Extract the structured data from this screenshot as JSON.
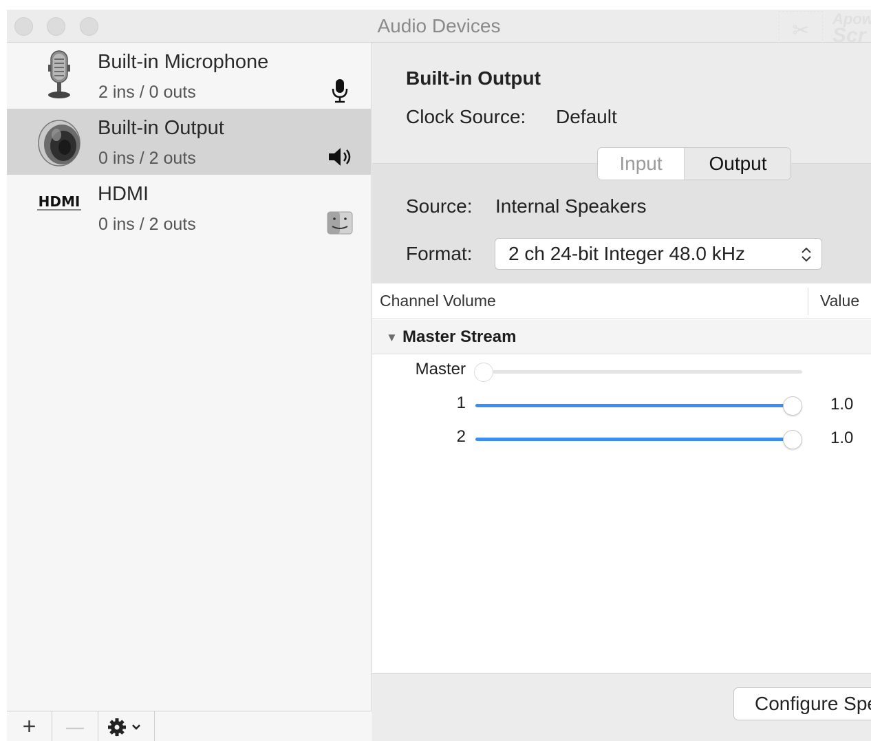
{
  "window": {
    "title": "Audio Devices"
  },
  "watermark": {
    "line1": "Apow",
    "line2": "Scr"
  },
  "devices": [
    {
      "name": "Built-in Microphone",
      "io": "2 ins / 0 outs",
      "icon": "microphone-icon",
      "badge": "mic-badge-icon",
      "selected": false
    },
    {
      "name": "Built-in Output",
      "io": "0 ins / 2 outs",
      "icon": "speaker-icon",
      "badge": "volume-badge-icon",
      "selected": true
    },
    {
      "name": "HDMI",
      "io": "0 ins / 2 outs",
      "icon": "hdmi-logo-icon",
      "icon_text": "HDMI",
      "badge": "finder-badge-icon",
      "selected": false
    }
  ],
  "sidebar_footer": {
    "add": "+",
    "remove": "—",
    "actions_icon": "gear-icon"
  },
  "detail": {
    "title": "Built-in Output",
    "clock_source_label": "Clock Source:",
    "clock_source_value": "Default",
    "tabs": [
      "Input",
      "Output"
    ],
    "selected_tab": "Output",
    "source_label": "Source:",
    "source_value": "Internal Speakers",
    "format_label": "Format:",
    "format_value": "2 ch 24-bit Integer 48.0 kHz"
  },
  "volume_table": {
    "columns": [
      "Channel Volume",
      "Value"
    ],
    "group": "Master Stream",
    "rows": [
      {
        "label": "Master",
        "level": 0.0,
        "value": "",
        "enabled": false
      },
      {
        "label": "1",
        "level": 1.0,
        "value": "1.0",
        "enabled": true
      },
      {
        "label": "2",
        "level": 1.0,
        "value": "1.0",
        "enabled": true
      }
    ]
  },
  "footer": {
    "configure_label": "Configure Speakers..."
  },
  "colors": {
    "accent": "#3b8df0",
    "selected_row": "#d4d4d4"
  }
}
